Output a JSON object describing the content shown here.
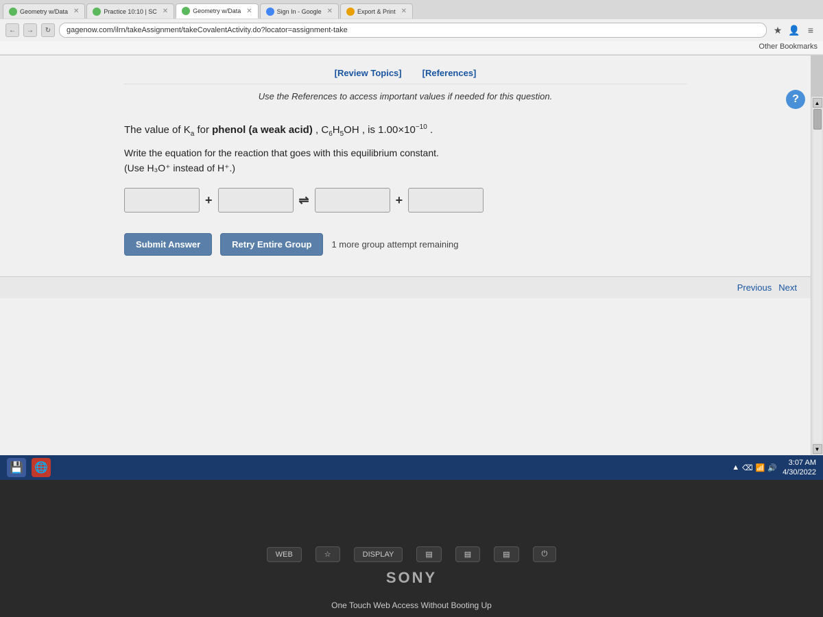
{
  "browser": {
    "tabs": [
      {
        "label": "Geometry w/Data",
        "active": false,
        "icon": "green"
      },
      {
        "label": "Practice 10:10 | SC",
        "active": false,
        "icon": "green"
      },
      {
        "label": "Geometry w/Data",
        "active": false,
        "icon": "green"
      },
      {
        "label": "Sign In - Google",
        "active": false,
        "icon": "orange"
      },
      {
        "label": "Export & Print",
        "active": false,
        "icon": "orange"
      }
    ],
    "address": "gagenow.com/ilrn/takeAssignment/takeCovalentActivity.do?locator=assignment-take",
    "bookmarks_label": "Other Bookmarks"
  },
  "page": {
    "ref_bar": {
      "review_topics": "[Review Topics]",
      "references": "[References]"
    },
    "use_references": "Use the References to access important values if needed for this question.",
    "question": {
      "ka_text": "The value of Ka for phenol (a weak acid) , C₆H₅OH , is 1.00×10⁻¹⁰ .",
      "instruction": "Write the equation for the reaction that goes with this equilibrium constant.",
      "note": "(Use H₃O⁺ instead of H⁺.)"
    },
    "buttons": {
      "submit": "Submit Answer",
      "retry": "Retry Entire Group",
      "attempt_text": "1 more group attempt remaining"
    },
    "navigation": {
      "previous": "Previous",
      "next": "Next"
    }
  },
  "taskbar": {
    "time": "3:07 AM",
    "date": "4/30/2022",
    "icons": [
      "signal",
      "flag",
      "network",
      "volume"
    ]
  },
  "laptop": {
    "sony_label": "SONY",
    "one_touch_label": "One Touch Web Access Without Booting Up",
    "buttons": [
      "WEB",
      "☆",
      "DISPLAY",
      "≡",
      "≡",
      "≡",
      "⏻"
    ]
  }
}
